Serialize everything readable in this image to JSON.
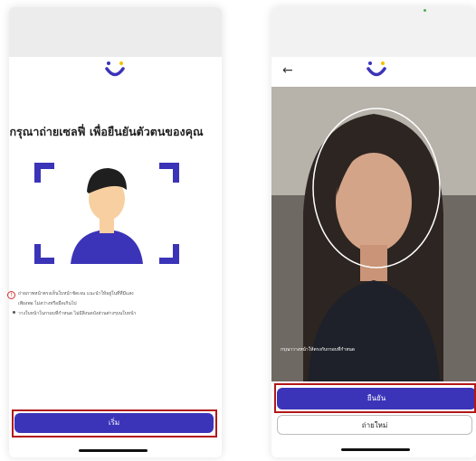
{
  "left_screen": {
    "title": "กรุณาถ่ายเซลฟี่ เพื่อยืนยันตัวตนของคุณ",
    "notes": [
      "ถ่ายภาพหน้าตรงเห็นใบหน้าชัดเจน แนะนำให้อยู่ในที่ที่มีแสง",
      "เพียงพอ ไม่สว่างหรือมืดเกินไป",
      "วางใบหน้าในกรอบที่กำหนด ไม่มีสิ่งบดบังส่วนต่างๆบนใบหน้า"
    ],
    "warning_icon": "!",
    "start_button": "เริ่ม"
  },
  "right_screen": {
    "back_icon": "←",
    "camera_caption": "กรุณาวางหน้าให้ตรงกับกรอบที่กำหนด",
    "confirm_button": "ยืนยัน",
    "retake_button": "ถ่ายใหม่"
  },
  "colors": {
    "brand_purple": "#3b34b8",
    "brand_yellow": "#f6c000",
    "highlight_red": "#b31818",
    "skin": "#f7cfa0",
    "hair": "#1f1f1f"
  },
  "icons": [
    "logo-icon",
    "warning-icon",
    "back-arrow-icon",
    "face-outline-icon"
  ]
}
